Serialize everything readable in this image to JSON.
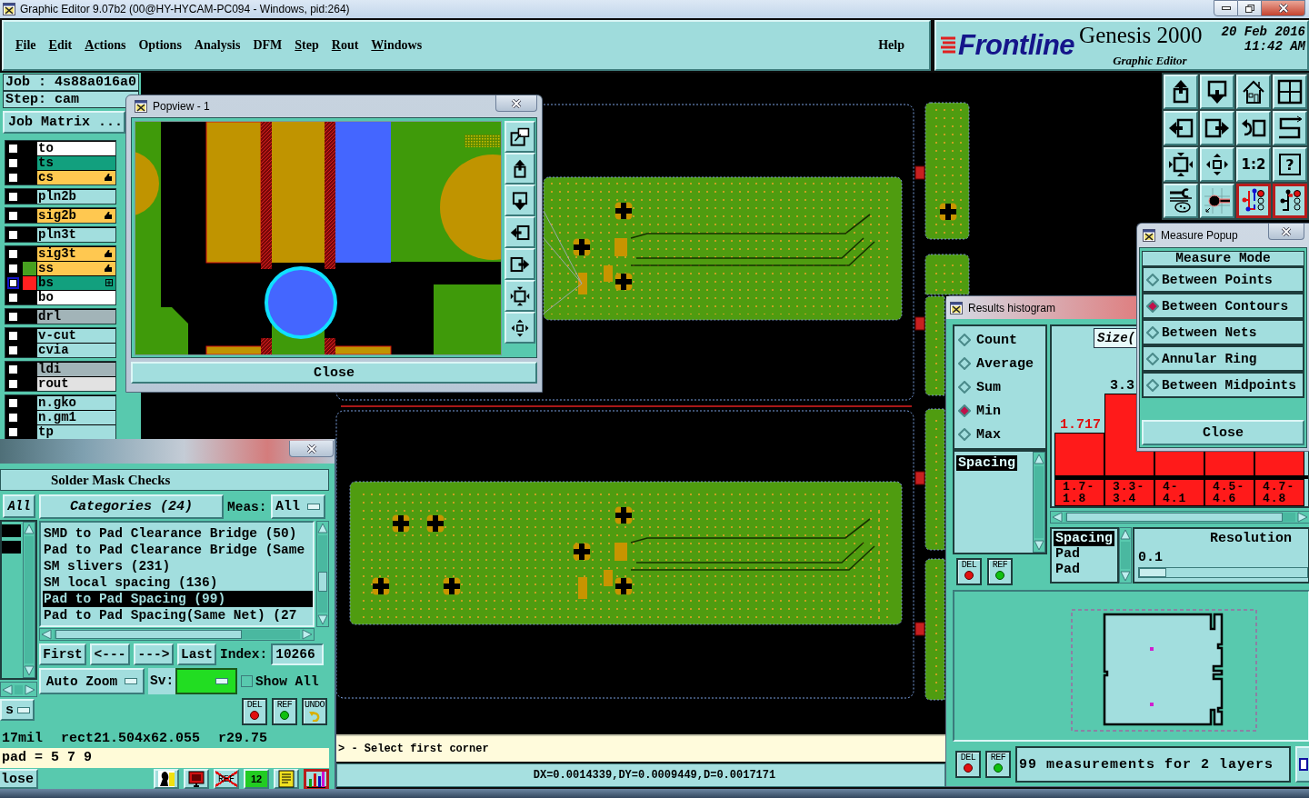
{
  "window": {
    "title": "Graphic Editor 9.07b2 (00@HY-HYCAM-PC094 - Windows, pid:264)"
  },
  "menu": {
    "items": [
      {
        "label": "File",
        "underline_first": true
      },
      {
        "label": "Edit",
        "underline_first": true
      },
      {
        "label": "Actions",
        "underline_first": true
      },
      {
        "label": "Options",
        "underline_first": false
      },
      {
        "label": "Analysis",
        "underline_first": false
      },
      {
        "label": "DFM",
        "underline_first": false
      },
      {
        "label": "Step",
        "underline_first": true
      },
      {
        "label": "Rout",
        "underline_first": true
      },
      {
        "label": "Windows",
        "underline_first": true
      }
    ],
    "help": {
      "label": "Help",
      "underline_first": false
    }
  },
  "brand": {
    "logo": "Frontline",
    "product": "Genesis 2000",
    "subtitle": "Graphic Editor",
    "date": "20 Feb 2016",
    "time": "11:42 AM"
  },
  "job": {
    "job": "Job : 4s88a016a0",
    "step": "Step: cam",
    "matrix_button": "Job Matrix ..."
  },
  "layer_groups": [
    {
      "layers": [
        {
          "name": "to",
          "color": "#ffffff",
          "checked": false,
          "selected": false,
          "affected": false
        },
        {
          "name": "ts",
          "color": "#12a07e",
          "checked": false,
          "selected": false,
          "affected": false
        },
        {
          "name": "cs",
          "color": "#ffc850",
          "checked": false,
          "selected": false,
          "affected": true
        }
      ]
    },
    {
      "layers": [
        {
          "name": "pln2b",
          "color": "#a2dede",
          "checked": false,
          "selected": false,
          "affected": false
        }
      ]
    },
    {
      "layers": [
        {
          "name": "sig2b",
          "color": "#ffc850",
          "checked": false,
          "selected": false,
          "affected": true
        }
      ]
    },
    {
      "layers": [
        {
          "name": "pln3t",
          "color": "#a2dede",
          "checked": false,
          "selected": false,
          "affected": false
        }
      ]
    },
    {
      "layers": [
        {
          "name": "sig3t",
          "color": "#ffc850",
          "checked": false,
          "selected": false,
          "affected": true
        },
        {
          "name": "ss",
          "color": "#ffc850",
          "swatch": {
            "color": "#48a020"
          },
          "checked": false,
          "selected": false,
          "affected": true
        },
        {
          "name": "bs",
          "color": "#12a07e",
          "swatch": {
            "color": "#ff2020"
          },
          "checked": false,
          "selected": true,
          "affected": false
        },
        {
          "name": "bo",
          "color": "#ffffff",
          "checked": false,
          "selected": false,
          "affected": false
        }
      ]
    },
    {
      "layers": [
        {
          "name": "drl",
          "color": "#a2b4b8",
          "checked": false,
          "selected": false,
          "affected": false
        }
      ]
    },
    {
      "layers": [
        {
          "name": "v-cut",
          "color": "#a2dede",
          "checked": false,
          "selected": false,
          "affected": false
        },
        {
          "name": "cvia",
          "color": "#a2dede",
          "checked": false,
          "selected": false,
          "affected": false
        }
      ]
    },
    {
      "layers": [
        {
          "name": "ldi",
          "color": "#a2b4b8",
          "checked": false,
          "selected": false,
          "affected": false
        },
        {
          "name": "rout",
          "color": "#e2e2e2",
          "checked": false,
          "selected": false,
          "affected": false
        }
      ]
    },
    {
      "layers": [
        {
          "name": "n.gko",
          "color": "#a2dede",
          "checked": false,
          "selected": false,
          "affected": false
        },
        {
          "name": "n.gm1",
          "color": "#a2dede",
          "checked": false,
          "selected": false,
          "affected": false
        },
        {
          "name": "tp",
          "color": "#a2dede",
          "checked": false,
          "selected": false,
          "affected": false
        }
      ]
    }
  ],
  "toolbar": [
    {
      "kind": "export",
      "on": false
    },
    {
      "kind": "import",
      "on": false
    },
    {
      "kind": "home",
      "on": false
    },
    {
      "kind": "grid",
      "on": false
    },
    {
      "kind": "left",
      "on": false
    },
    {
      "kind": "right",
      "on": false
    },
    {
      "kind": "undo",
      "on": false
    },
    {
      "kind": "snake",
      "on": false
    },
    {
      "kind": "fit",
      "on": false
    },
    {
      "kind": "center",
      "on": false
    },
    {
      "kind": "text",
      "label": "1:2",
      "on": false
    },
    {
      "kind": "boxed",
      "label": "?",
      "on": false
    },
    {
      "kind": "tools",
      "on": false
    },
    {
      "kind": "probe",
      "on": false
    },
    {
      "kind": "netlist",
      "on": true
    },
    {
      "kind": "netcheck",
      "on": true
    }
  ],
  "command_line": {
    "text": "> - Select first corner"
  },
  "status_bar": {
    "text": "DX=0.0014339,DY=0.0009449,D=0.0017171"
  },
  "popview": {
    "title": "Popview - 1",
    "close_button": "Close"
  },
  "solder_mask": {
    "header": "Solder Mask Checks",
    "side": {
      "all_button": "All",
      "rows": [
        {
          "selected": true
        },
        {
          "selected": true
        }
      ],
      "dropdown": "s"
    },
    "categories_button": "Categories (24)",
    "meas_label": "Meas:",
    "meas_value": "All",
    "categories": [
      {
        "label": "SMD to Pad Clearance Bridge (50)",
        "selected": false
      },
      {
        "label": "Pad to Pad Clearance Bridge (Same",
        "selected": false
      },
      {
        "label": "SM slivers (231)",
        "selected": false
      },
      {
        "label": "SM local spacing (136)",
        "selected": false
      },
      {
        "label": "Pad to Pad Spacing (99)",
        "selected": true
      },
      {
        "label": "Pad to Pad Spacing(Same Net) (27",
        "selected": false
      }
    ],
    "nav": [
      "First",
      "<---",
      "--->",
      "Last"
    ],
    "index_label": "Index:",
    "index_value": "10266",
    "zoom_mode": "Auto Zoom",
    "sv_label": "Sv:",
    "show_all": {
      "label": "Show All",
      "checked": false
    },
    "actions": [
      {
        "kind": "del",
        "label": "DEL"
      },
      {
        "kind": "ref",
        "label": "REF"
      },
      {
        "kind": "undo",
        "label": "UNDO"
      }
    ],
    "info": [
      "17mil",
      "rect21.504x62.055",
      "r29.75"
    ],
    "pad_line": "pad = 5 7 9",
    "close_button": "lose",
    "tools": [
      {
        "kind": "person",
        "on": false
      },
      {
        "kind": "monitor",
        "on": false
      },
      {
        "kind": "crossed",
        "label": "REF",
        "on": false
      },
      {
        "kind": "numbers",
        "label": "12",
        "on": false
      },
      {
        "kind": "notes",
        "on": false
      },
      {
        "kind": "chart",
        "on": true
      }
    ]
  },
  "histogram": {
    "title": "Results histogram",
    "modes": [
      {
        "label": "Count",
        "selected": false
      },
      {
        "label": "Average",
        "selected": false
      },
      {
        "label": "Sum",
        "selected": false
      },
      {
        "label": "Min",
        "selected": true
      },
      {
        "label": "Max",
        "selected": false
      }
    ],
    "measures": [
      {
        "label": "Spacing",
        "selected": true
      }
    ],
    "side_buttons": [
      {
        "kind": "del",
        "label": "DEL"
      },
      {
        "kind": "ref",
        "label": "REF"
      }
    ],
    "header": "Size(",
    "bars": [
      {
        "category": "1.7-1.8",
        "value_label": "1.717",
        "highlighted": true
      },
      {
        "category": "3.3-3.4",
        "value_label": "3.3",
        "highlighted": false
      },
      {
        "category": "4-4.1"
      },
      {
        "category": "4.5-4.6"
      },
      {
        "category": "4.7-4.8"
      }
    ],
    "sub_list": [
      {
        "label": "Spacing",
        "selected": true
      },
      {
        "label": "Pad",
        "selected": false
      },
      {
        "label": "Pad",
        "selected": false
      }
    ],
    "resolution": {
      "label": "Resolution",
      "value": "0.1",
      "level": 0
    },
    "footer_buttons": [
      {
        "kind": "del",
        "label": "DEL"
      },
      {
        "kind": "ref",
        "label": "REF"
      }
    ],
    "summary": "99 measurements for 2 layers"
  },
  "measure_popup": {
    "title": "Measure Popup",
    "heading": "Measure Mode",
    "modes": [
      {
        "label": "Between Points",
        "selected": false
      },
      {
        "label": "Between Contours",
        "selected": true
      },
      {
        "label": "Between Nets",
        "selected": false
      },
      {
        "label": "Annular Ring",
        "selected": false
      },
      {
        "label": "Between Midpoints",
        "selected": false
      }
    ],
    "close_button": "Close"
  }
}
